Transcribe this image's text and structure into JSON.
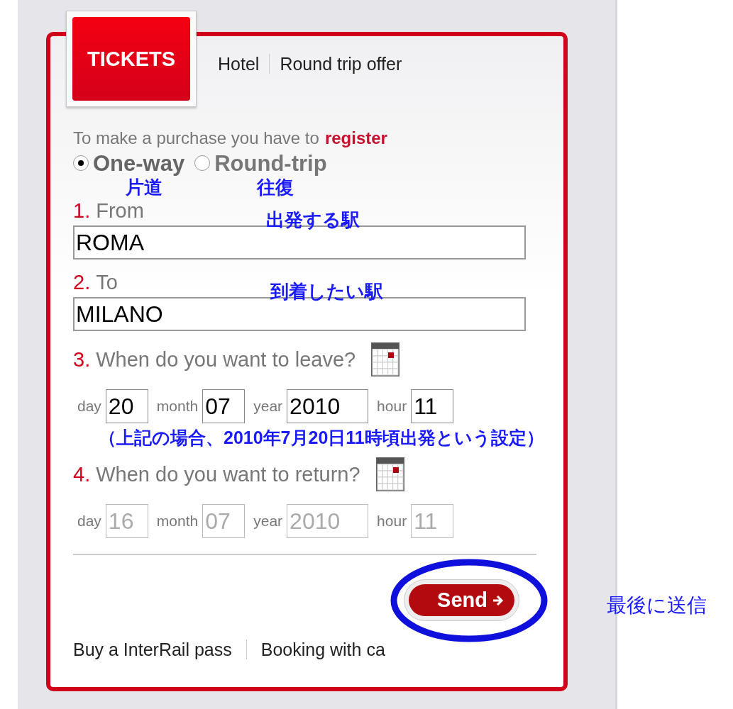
{
  "tabs": [
    {
      "label": "TICKETS",
      "selected": true
    },
    {
      "label": "Hotel",
      "selected": false
    },
    {
      "label": "Round trip offer",
      "selected": false
    }
  ],
  "notice": {
    "text": "To make a purchase you have to",
    "link": "register"
  },
  "trip_type": [
    {
      "label": "One-way",
      "selected": true,
      "annotation": "片道"
    },
    {
      "label": "Round-trip",
      "selected": false,
      "annotation": "往復"
    }
  ],
  "stations": [
    {
      "number": "1.",
      "label": "From",
      "value": "ROMA",
      "annotation": "出発する駅"
    },
    {
      "number": "2.",
      "label": "To",
      "value": "MILANO",
      "annotation": "到着したい駅"
    }
  ],
  "dates": [
    {
      "number": "3.",
      "label": "When do you want to leave?",
      "disabled": false,
      "annotation": "（上記の場合、2010年7月20日11時頃出発という設定）",
      "fields": [
        {
          "label": "day",
          "value": "20"
        },
        {
          "label": "month",
          "value": "07"
        },
        {
          "label": "year",
          "value": "2010"
        },
        {
          "label": "hour",
          "value": "11"
        }
      ]
    },
    {
      "number": "4.",
      "label": "When do you want to return?",
      "disabled": true,
      "fields": [
        {
          "label": "day",
          "value": "16"
        },
        {
          "label": "month",
          "value": "07"
        },
        {
          "label": "year",
          "value": "2010"
        },
        {
          "label": "hour",
          "value": "11"
        }
      ]
    }
  ],
  "send": {
    "label": "Send",
    "annotation": "最後に送信"
  },
  "footer_links": [
    "Buy a InterRail pass",
    "Booking with ca"
  ]
}
